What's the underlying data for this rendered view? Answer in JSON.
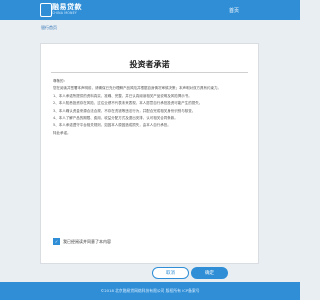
{
  "header": {
    "logo_text": "融易贷款",
    "logo_subtext": "CHINA MONEY",
    "home_link": "首页"
  },
  "breadcrumb": "银行首页",
  "card": {
    "title": "投资者承诺",
    "paragraphs": [
      "尊敬的：",
      "您在阅读并签署本声明前，请确保已充分理解产品风险并根据自身情况审慎决策；本声明对双方具有约束力。",
      "1、本人承诺所提供的资料真实、准确、完整，并已认真阅读相关产品说明及风险揭示书。",
      "2、本人知悉投资存在风险，过往业绩不代表未来表现，本人愿意自行承担投资可能产生的损失。",
      "3、本人确认资金来源合法合规，不存在洗钱等违法行为，并配合完成相关身份识别与核查。",
      "4、本人了解产品的期限、费用、收益分配方式及退出安排，认可相关合同条款。",
      "5、本人承诺遵守平台相关规则，如因本人原因造成损失，由本人自行承担。",
      "特此承诺。"
    ],
    "agree_label": "我已经阅读并同意了本内容",
    "agree_checked": true,
    "cancel_label": "取消",
    "ok_label": "确定"
  },
  "footer_text": "©2018 北京融易贷网络科技有限公司 版权所有 ICP备案号"
}
